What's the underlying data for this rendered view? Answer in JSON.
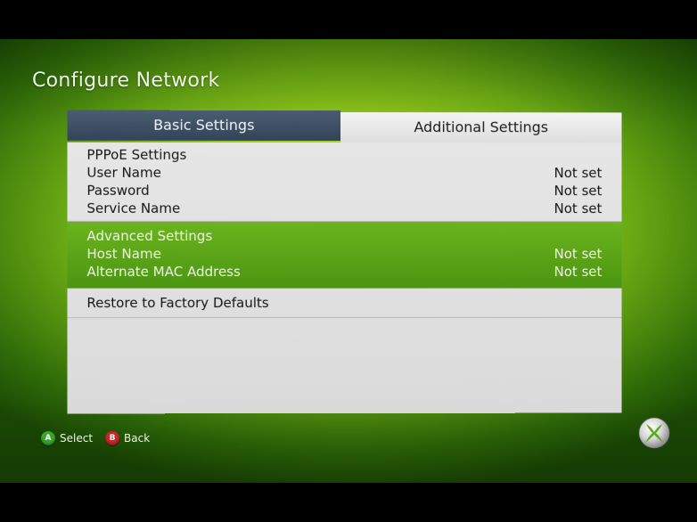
{
  "title": "Configure Network",
  "tabs": [
    {
      "label": "Basic Settings"
    },
    {
      "label": "Additional Settings"
    }
  ],
  "pppoe": {
    "heading": "PPPoE Settings",
    "items": [
      {
        "label": "User Name",
        "value": "Not set"
      },
      {
        "label": "Password",
        "value": "Not set"
      },
      {
        "label": "Service Name",
        "value": "Not set"
      }
    ]
  },
  "advanced": {
    "heading": "Advanced Settings",
    "items": [
      {
        "label": "Host Name",
        "value": "Not set"
      },
      {
        "label": "Alternate MAC Address",
        "value": "Not set"
      }
    ]
  },
  "factory": {
    "label": "Restore to Factory Defaults"
  },
  "footer": {
    "a_glyph": "A",
    "a_label": "Select",
    "b_glyph": "B",
    "b_label": "Back"
  },
  "colors": {
    "button_a": "#3aa52e",
    "button_b": "#c8262a",
    "selection": "#5aa618",
    "tab_active": "#3a4b60"
  },
  "icons": {
    "logo": "xbox-logo-icon"
  }
}
